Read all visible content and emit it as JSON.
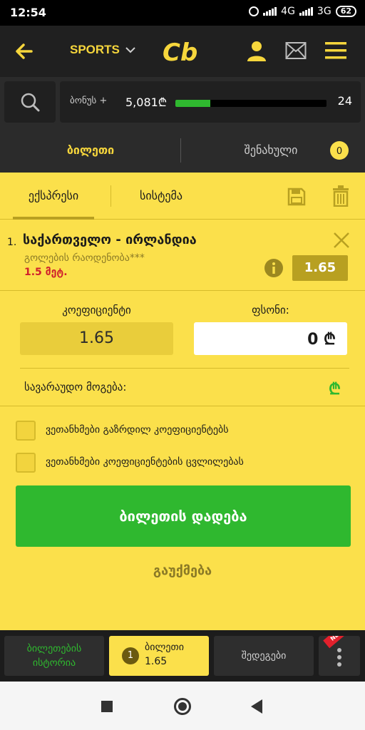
{
  "status_bar": {
    "time": "12:54",
    "network1": "4G",
    "network2": "3G",
    "battery": "62"
  },
  "header": {
    "sports_label": "SPORTS",
    "logo_text": "Cb"
  },
  "bonus": {
    "label": "ბონუს +",
    "amount": "5,081₾",
    "progress": 0.23,
    "count": "24"
  },
  "main_tabs": {
    "ticket": "ბილეთი",
    "saved": "შენახული",
    "saved_count": "0"
  },
  "sub_tabs": {
    "express": "ექსპრესი",
    "system": "სისტემა"
  },
  "bet": {
    "number": "1.",
    "match": "საქართველო - ირლანდია",
    "market": "გოლების რაოდენობა***",
    "pick": "1.5 მეტ.",
    "odd": "1.65"
  },
  "form": {
    "coef_label": "კოეფიციენტი",
    "coef_value": "1.65",
    "stake_label": "ფსონი:",
    "stake_value": "0 ₾",
    "win_label": "სავარაუდო მოგება:",
    "currency": "₾"
  },
  "options": {
    "agree_increase": "ვეთანხმები გაზრდილ კოეფიციენტებს",
    "agree_change": "ვეთანხმები კოეფიციენტების ცვლილებას"
  },
  "actions": {
    "place_bet": "ბილეთის დადება",
    "cancel": "გაუქმება"
  },
  "bottom_bar": {
    "history_line1": "ბილეთების",
    "history_line2": "ისტორია",
    "slip_count": "1",
    "slip_label": "ბილეთი",
    "slip_odd": "1.65",
    "results": "შედეგები",
    "new_badge": "NEW"
  },
  "colors": {
    "accent_yellow": "#fbe04b",
    "dark_bg": "#202020",
    "green": "#2fb82f",
    "red": "#d0202c"
  }
}
